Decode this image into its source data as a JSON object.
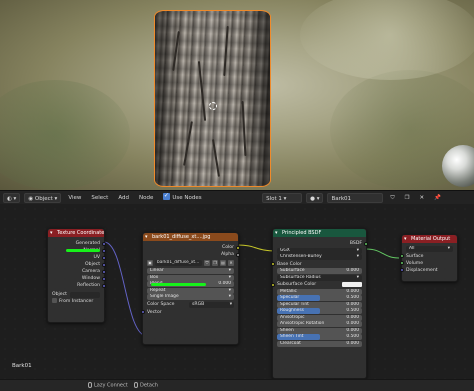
{
  "header": {
    "editor_type": "",
    "object_mode": "Object",
    "menus": [
      "View",
      "Select",
      "Add",
      "Node"
    ],
    "use_nodes_label": "Use Nodes",
    "use_nodes": true,
    "slot": "Slot 1",
    "material_name": "Bark01"
  },
  "nodes": {
    "texcoord": {
      "title": "Texture Coordinate",
      "outputs": [
        "Generated",
        "Normal",
        "UV",
        "Object",
        "Camera",
        "Window",
        "Reflection"
      ],
      "object_label": "Object",
      "from_instancer": "From Instancer"
    },
    "image": {
      "title": "bark01_diffuse_xt....jpg",
      "outputs": [
        "Color",
        "Alpha"
      ],
      "image_name": "bark01_diffuse_xt...",
      "interpolation": "Linear",
      "projection": "Box",
      "blend_label": "Blend",
      "blend_value": "0.000",
      "extension": "Repeat",
      "source": "Single Image",
      "color_space_label": "Color Space",
      "color_space": "sRGB",
      "vector_label": "Vector"
    },
    "bsdf": {
      "title": "Principled BSDF",
      "output": "BSDF",
      "distribution": "GGX",
      "subsurface_method": "Christensen-Burley",
      "base_color": "Base Color",
      "subsurface": {
        "label": "Subsurface",
        "value": "0.000"
      },
      "subsurface_radius": "Subsurface Radius",
      "subsurface_color": "Subsurface Color",
      "params": [
        {
          "label": "Metallic",
          "value": "0.000",
          "fill": 0.0
        },
        {
          "label": "Specular",
          "value": "0.500",
          "fill": 0.5
        },
        {
          "label": "Specular Tint",
          "value": "0.000",
          "fill": 0.0
        },
        {
          "label": "Roughness",
          "value": "0.500",
          "fill": 0.5
        },
        {
          "label": "Anisotropic",
          "value": "0.000",
          "fill": 0.0
        },
        {
          "label": "Anisotropic Rotation",
          "value": "0.000",
          "fill": 0.0
        },
        {
          "label": "Sheen",
          "value": "0.000",
          "fill": 0.0
        },
        {
          "label": "Sheen Tint",
          "value": "0.500",
          "fill": 0.5
        },
        {
          "label": "Clearcoat",
          "value": "0.000",
          "fill": 0.0
        }
      ]
    },
    "output": {
      "title": "Material Output",
      "target": "All",
      "inputs": [
        "Surface",
        "Volume",
        "Displacement"
      ]
    }
  },
  "object_label": "Bark01",
  "statusbar": {
    "lazy_connect": "Lazy Connect",
    "detach": "Detach"
  },
  "colors": {
    "accent": "#4772b3",
    "selection_outline": "#f08a2a",
    "link_highlight": "#17f21a"
  }
}
